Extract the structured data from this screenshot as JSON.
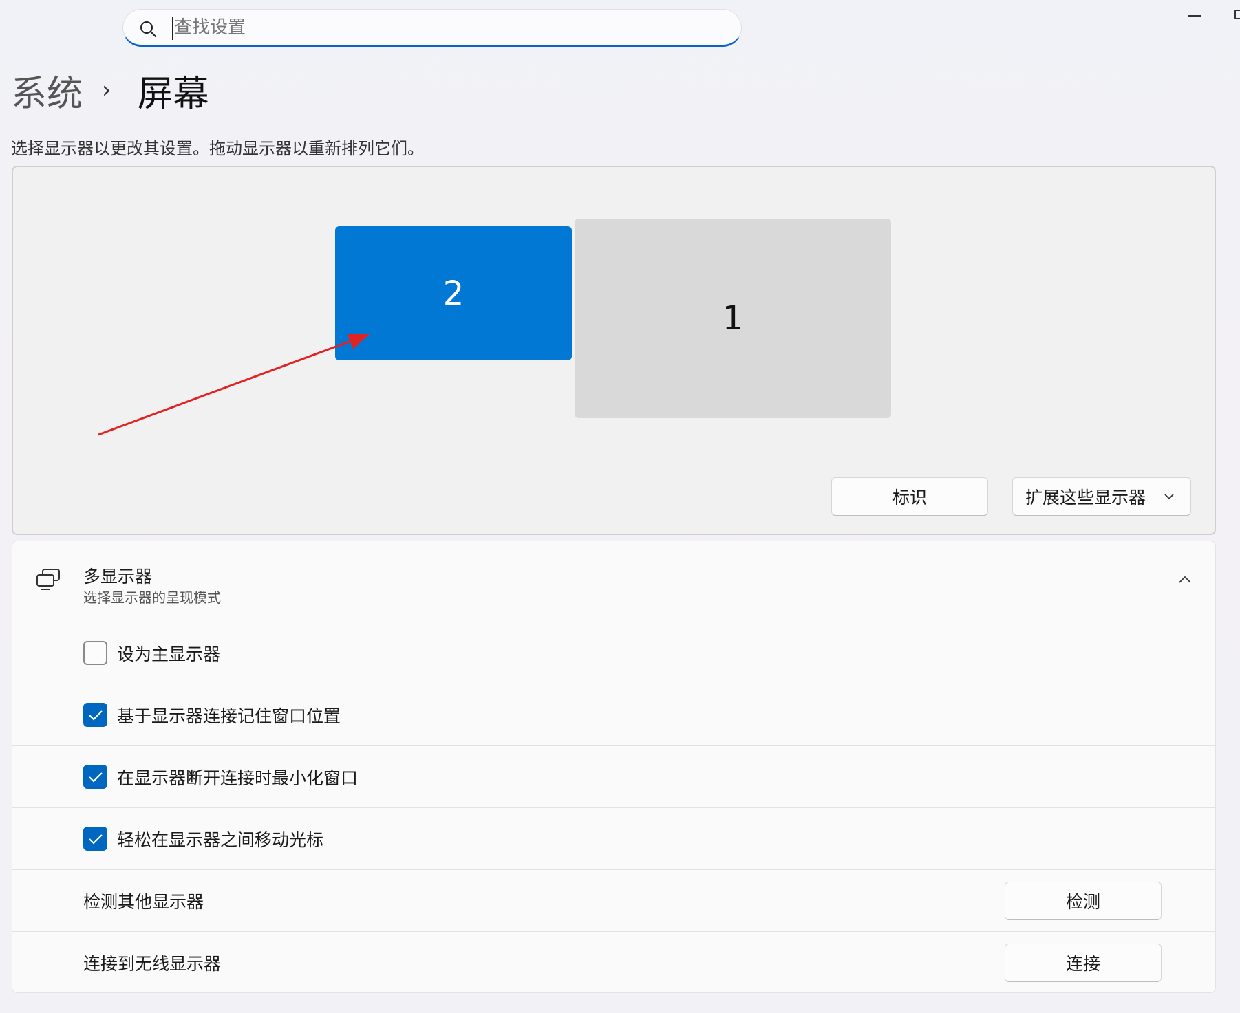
{
  "search": {
    "placeholder": "查找设置"
  },
  "breadcrumb": {
    "parent": "系统",
    "separator": "›",
    "current": "屏幕"
  },
  "description": "选择显示器以更改其设置。拖动显示器以重新排列它们。",
  "arrangement": {
    "monitors": [
      {
        "label": "2",
        "selected": true,
        "color": "#0078d4"
      },
      {
        "label": "1",
        "selected": false,
        "color": "#d9d9d9"
      }
    ],
    "identify_label": "标识",
    "mode_label": "扩展这些显示器",
    "annotation_arrow_color": "#e02424"
  },
  "multi_display": {
    "title": "多显示器",
    "subtitle": "选择显示器的呈现模式",
    "expanded": true,
    "options": [
      {
        "label": "设为主显示器",
        "checked": false
      },
      {
        "label": "基于显示器连接记住窗口位置",
        "checked": true
      },
      {
        "label": "在显示器断开连接时最小化窗口",
        "checked": true
      },
      {
        "label": "轻松在显示器之间移动光标",
        "checked": true
      }
    ],
    "detect": {
      "label": "检测其他显示器",
      "button": "检测"
    },
    "wireless": {
      "label": "连接到无线显示器",
      "button": "连接"
    }
  },
  "accent_color": "#0067c0"
}
